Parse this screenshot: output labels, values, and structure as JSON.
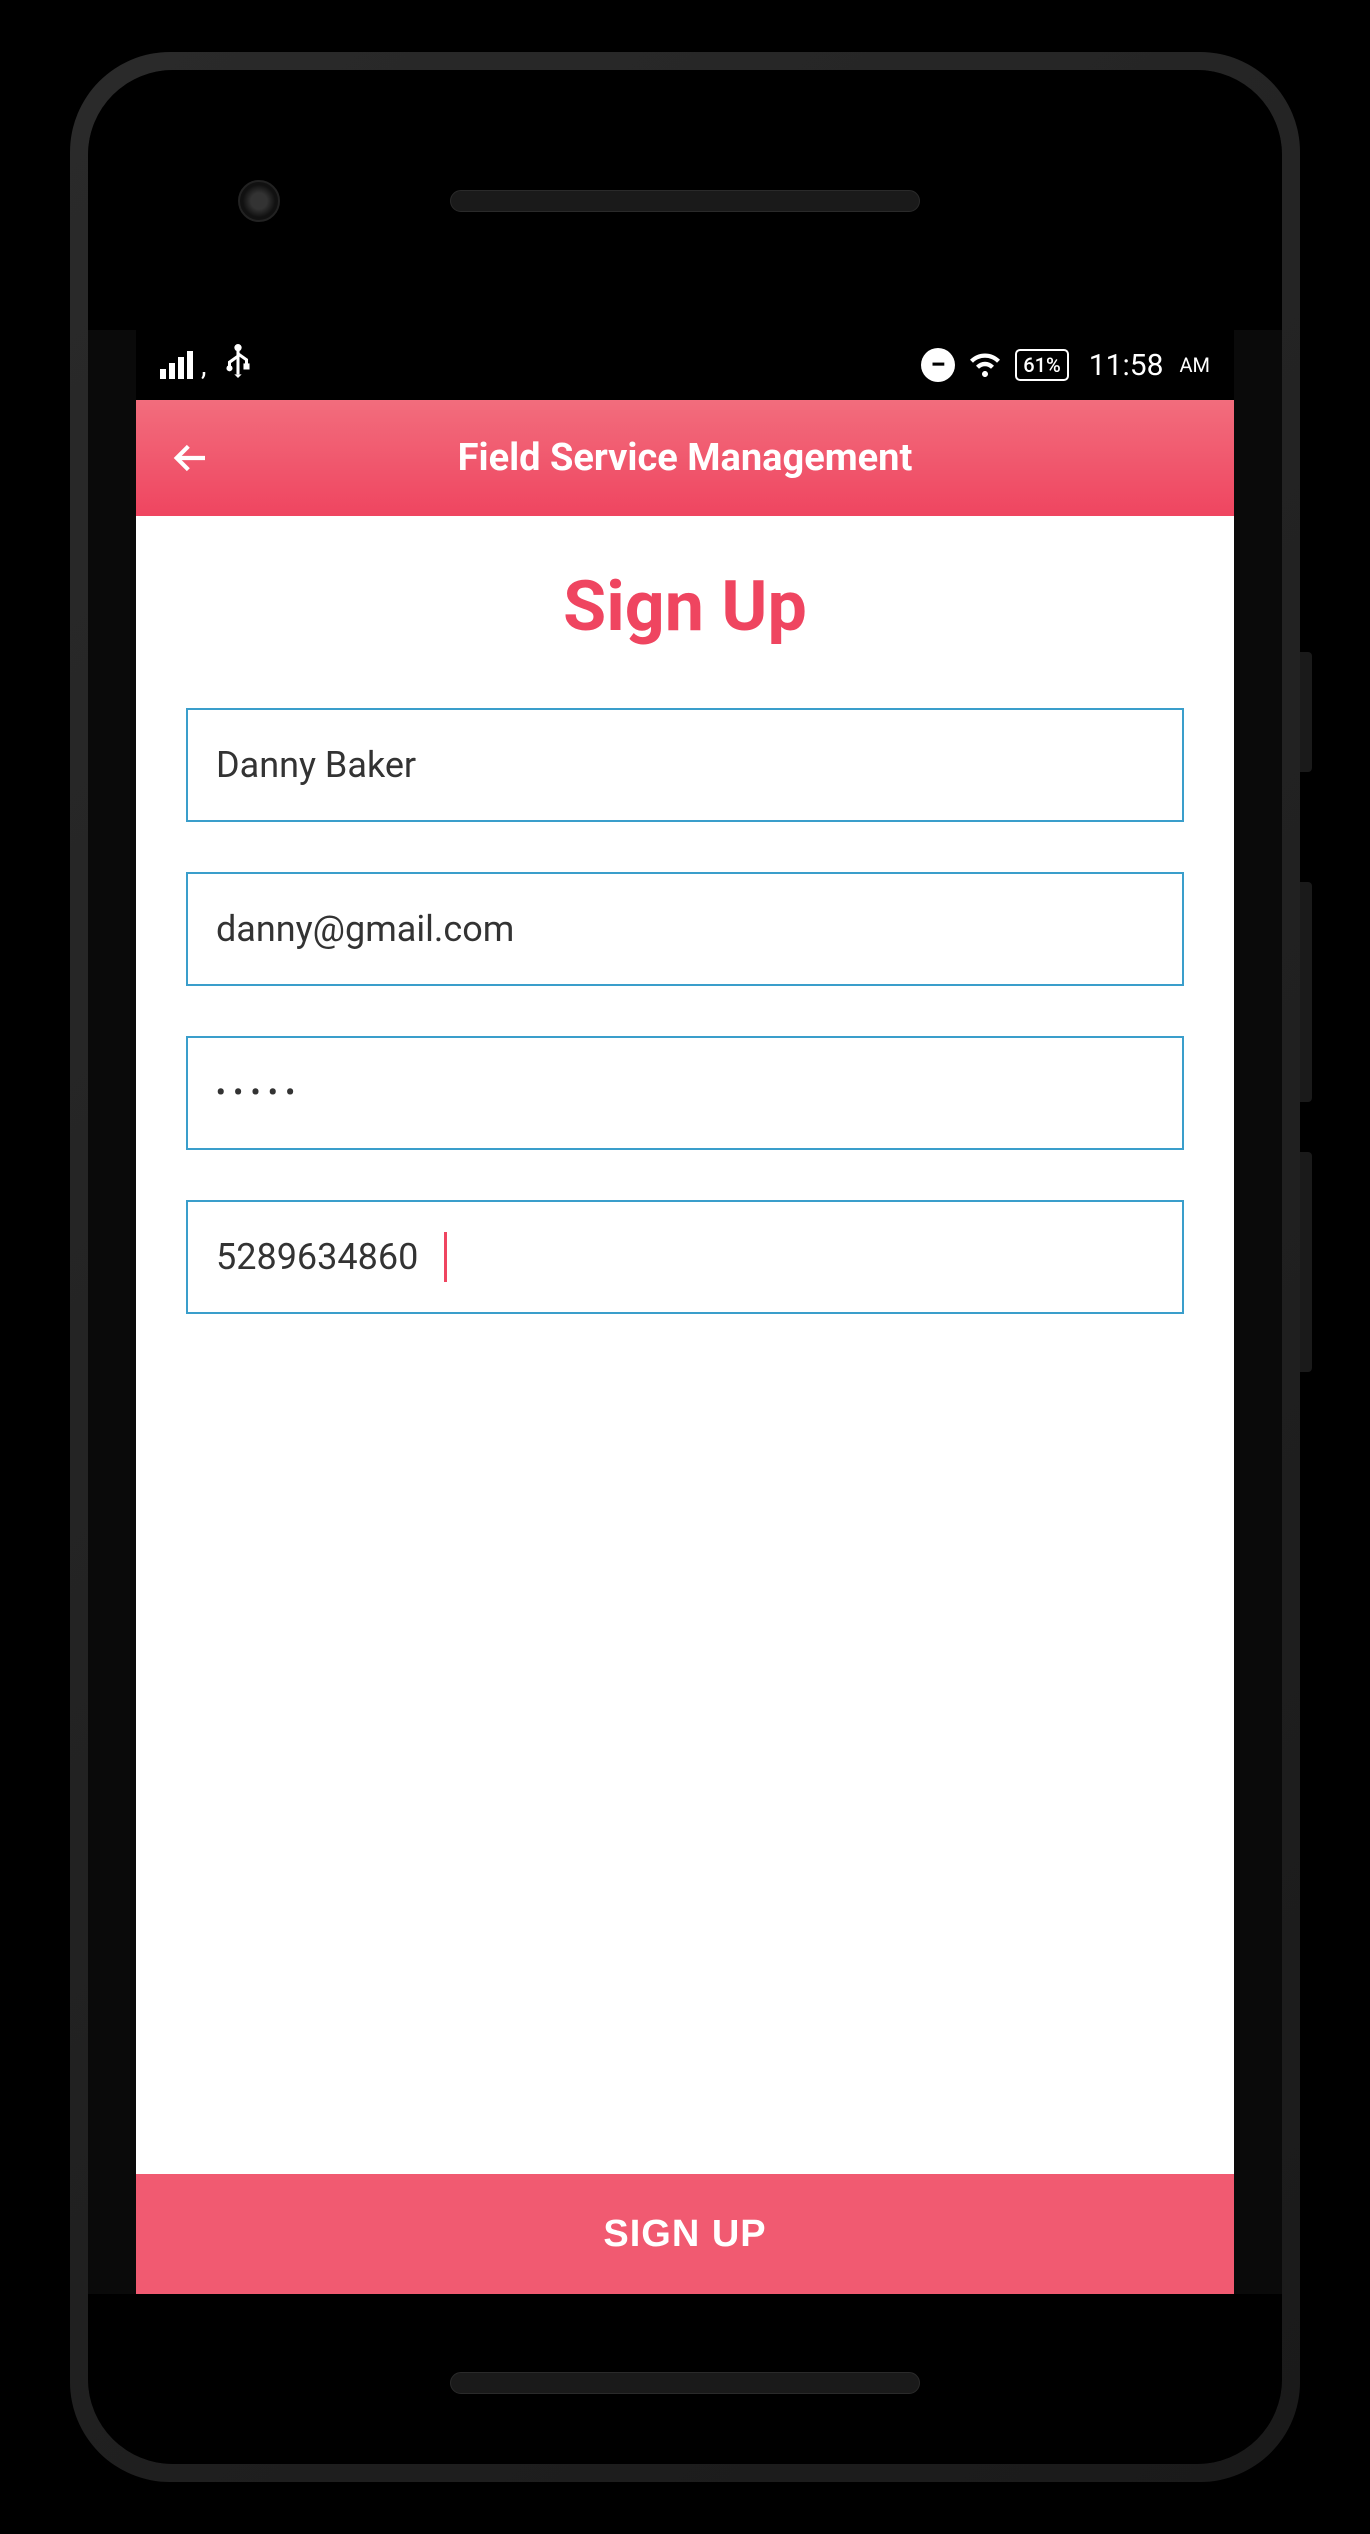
{
  "status_bar": {
    "battery_percent": "61%",
    "time": "11:58",
    "ampm": "AM"
  },
  "header": {
    "title": "Field Service Management"
  },
  "page": {
    "heading": "Sign Up"
  },
  "form": {
    "name_value": "Danny Baker",
    "email_value": "danny@gmail.com",
    "password_value": "•••••",
    "phone_value": "5289634860"
  },
  "actions": {
    "signup_label": "SIGN UP"
  }
}
